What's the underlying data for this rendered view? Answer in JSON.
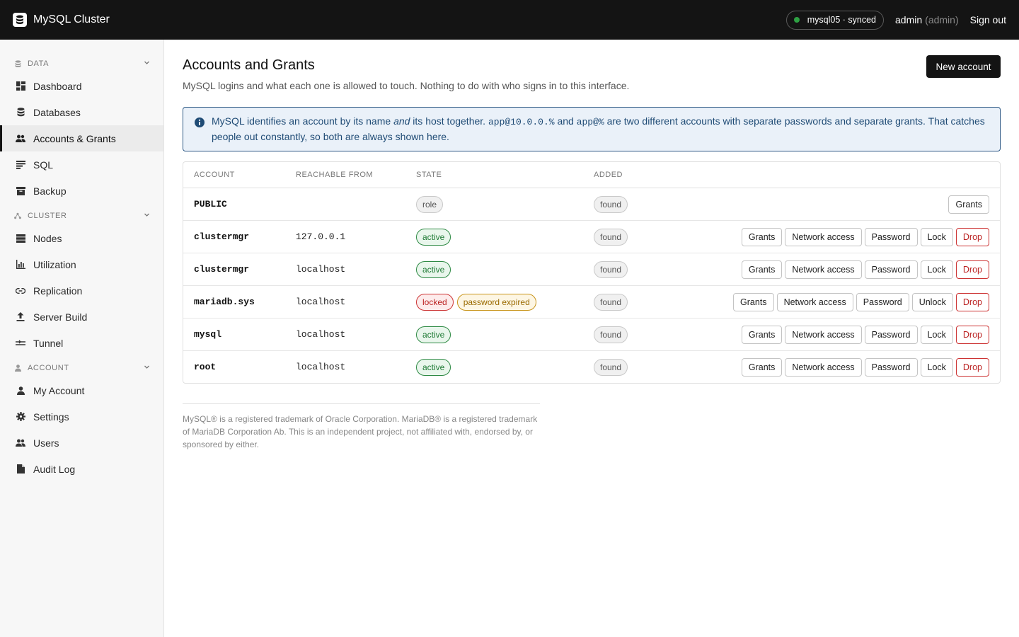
{
  "app": {
    "title": "MySQL Cluster"
  },
  "topbar": {
    "node_status": "mysql05 · synced",
    "user": "admin",
    "user_role": "(admin)",
    "signout_label": "Sign out",
    "status_color": "#2ea043"
  },
  "sidebar": {
    "sections": [
      {
        "label": "DATA",
        "icon": "database-icon",
        "items": [
          {
            "label": "Dashboard",
            "icon": "dashboard-icon"
          },
          {
            "label": "Databases",
            "icon": "database-icon"
          },
          {
            "label": "Accounts & Grants",
            "icon": "users-icon",
            "active": true
          },
          {
            "label": "SQL",
            "icon": "sql-icon"
          },
          {
            "label": "Backup",
            "icon": "archive-icon"
          }
        ]
      },
      {
        "label": "CLUSTER",
        "icon": "cluster-icon",
        "items": [
          {
            "label": "Nodes",
            "icon": "server-icon"
          },
          {
            "label": "Utilization",
            "icon": "bar-chart-icon"
          },
          {
            "label": "Replication",
            "icon": "link-icon"
          },
          {
            "label": "Server Build",
            "icon": "upload-icon"
          },
          {
            "label": "Tunnel",
            "icon": "tunnel-icon"
          }
        ]
      },
      {
        "label": "ACCOUNT",
        "icon": "person-icon",
        "items": [
          {
            "label": "My Account",
            "icon": "person-icon"
          },
          {
            "label": "Settings",
            "icon": "gear-icon"
          },
          {
            "label": "Users",
            "icon": "users-icon"
          },
          {
            "label": "Audit Log",
            "icon": "file-icon"
          }
        ]
      }
    ]
  },
  "page": {
    "title": "Accounts and Grants",
    "subtitle": "MySQL logins and what each one is allowed to touch. Nothing to do with who signs in to this interface.",
    "new_button": "New account"
  },
  "info": {
    "t1": "MySQL identifies an account by its name ",
    "em": "and",
    "t2": " its host together. ",
    "code1": "app@10.0.0.%",
    "t3": " and ",
    "code2": "app@%",
    "t4": " are two different accounts with separate passwords and separate grants. That catches people out constantly, so both are always shown here."
  },
  "table": {
    "headers": {
      "account": "ACCOUNT",
      "host": "REACHABLE FROM",
      "state": "STATE",
      "added": "ADDED"
    },
    "rows": [
      {
        "account": "PUBLIC",
        "host": "",
        "states": [
          {
            "label": "role",
            "kind": "role"
          }
        ],
        "added": "found",
        "actions": [
          "Grants"
        ]
      },
      {
        "account": "clustermgr",
        "host": "127.0.0.1",
        "states": [
          {
            "label": "active",
            "kind": "active"
          }
        ],
        "added": "found",
        "actions": [
          "Grants",
          "Network access",
          "Password",
          "Lock",
          "Drop"
        ]
      },
      {
        "account": "clustermgr",
        "host": "localhost",
        "states": [
          {
            "label": "active",
            "kind": "active"
          }
        ],
        "added": "found",
        "actions": [
          "Grants",
          "Network access",
          "Password",
          "Lock",
          "Drop"
        ]
      },
      {
        "account": "mariadb.sys",
        "host": "localhost",
        "states": [
          {
            "label": "locked",
            "kind": "locked"
          },
          {
            "label": "password expired",
            "kind": "expired"
          }
        ],
        "added": "found",
        "actions": [
          "Grants",
          "Network access",
          "Password",
          "Unlock",
          "Drop"
        ]
      },
      {
        "account": "mysql",
        "host": "localhost",
        "states": [
          {
            "label": "active",
            "kind": "active"
          }
        ],
        "added": "found",
        "actions": [
          "Grants",
          "Network access",
          "Password",
          "Lock",
          "Drop"
        ]
      },
      {
        "account": "root",
        "host": "localhost",
        "states": [
          {
            "label": "active",
            "kind": "active"
          }
        ],
        "added": "found",
        "actions": [
          "Grants",
          "Network access",
          "Password",
          "Lock",
          "Drop"
        ]
      }
    ]
  },
  "footer": {
    "text": "MySQL® is a registered trademark of Oracle Corporation. MariaDB® is a registered trademark of MariaDB Corporation Ab. This is an independent project, not affiliated with, endorsed by, or sponsored by either."
  }
}
